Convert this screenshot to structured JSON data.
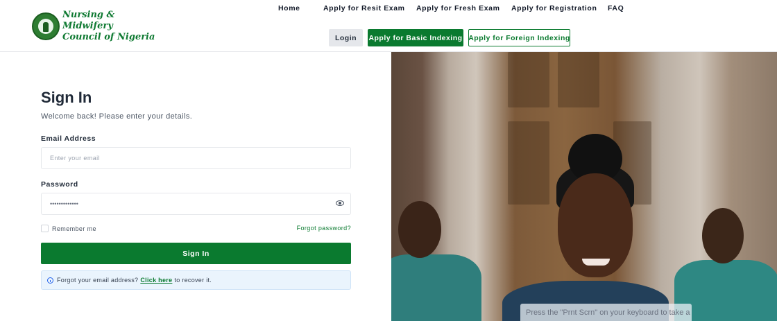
{
  "brand": {
    "line1": "Nursing &",
    "line2": "Midwifery",
    "line3": "Council of Nigeria",
    "accent_color": "#0a7a2f"
  },
  "nav": {
    "home": "Home",
    "resit": "Apply for Resit Exam",
    "fresh": "Apply for Fresh Exam",
    "registration": "Apply for Registration",
    "faq": "FAQ"
  },
  "header_buttons": {
    "login": "Login",
    "basic_indexing": "Apply for Basic Indexing",
    "foreign_indexing": "Apply for Foreign Indexing"
  },
  "form": {
    "title": "Sign In",
    "subtitle": "Welcome back! Please enter your details.",
    "email_label": "Email Address",
    "email_placeholder": "Enter your email",
    "password_label": "Password",
    "password_value": "•••••••••••••",
    "remember_label": "Remember me",
    "forgot_password": "Forgot password?",
    "submit_label": "Sign In",
    "recover_prefix": "Forgot your email address?",
    "recover_link": "Click here",
    "recover_suffix": "to recover it."
  },
  "overlay": {
    "text": "Press the \"Prnt Scrn\" on your keyboard to take a"
  },
  "icons": {
    "seal": "nmcn-seal-icon",
    "eye": "eye-icon",
    "info": "info-icon"
  }
}
